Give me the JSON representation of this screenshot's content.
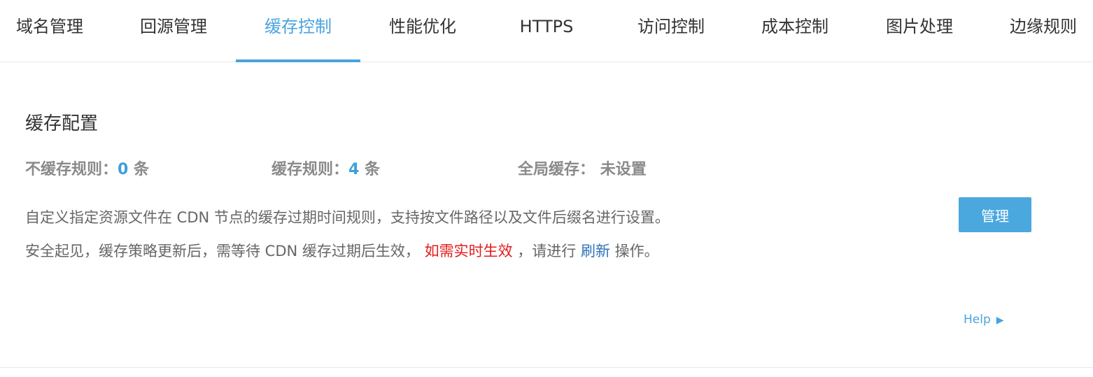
{
  "tabs": [
    {
      "label": "域名管理"
    },
    {
      "label": "回源管理"
    },
    {
      "label": "缓存控制",
      "active": true
    },
    {
      "label": "性能优化"
    },
    {
      "label": "HTTPS"
    },
    {
      "label": "访问控制"
    },
    {
      "label": "成本控制"
    },
    {
      "label": "图片处理"
    },
    {
      "label": "边缘规则"
    }
  ],
  "cache_config": {
    "title": "缓存配置",
    "stats": {
      "no_cache_label": "不缓存规则：",
      "no_cache_count": "0",
      "no_cache_unit": "条",
      "cache_label": "缓存规则：",
      "cache_count": "4",
      "cache_unit": "条",
      "global_label": "全局缓存：",
      "global_value": "未设置"
    },
    "desc_line1": "自定义指定资源文件在 CDN 节点的缓存过期时间规则，支持按文件路径以及文件后缀名进行设置。",
    "desc_line2_prefix": "安全起见，缓存策略更新后，需等待 CDN 缓存过期后生效，",
    "desc_line2_warn": "如需实时生效",
    "desc_line2_mid": "，请进行",
    "desc_line2_link": "刷新",
    "desc_line2_suffix": "操作。",
    "manage_button": "管理",
    "help_label": "Help",
    "help_arrow": "▶"
  },
  "colors": {
    "accent": "#4aa3df",
    "warning": "#e41b1b",
    "link": "#2e73b8"
  }
}
